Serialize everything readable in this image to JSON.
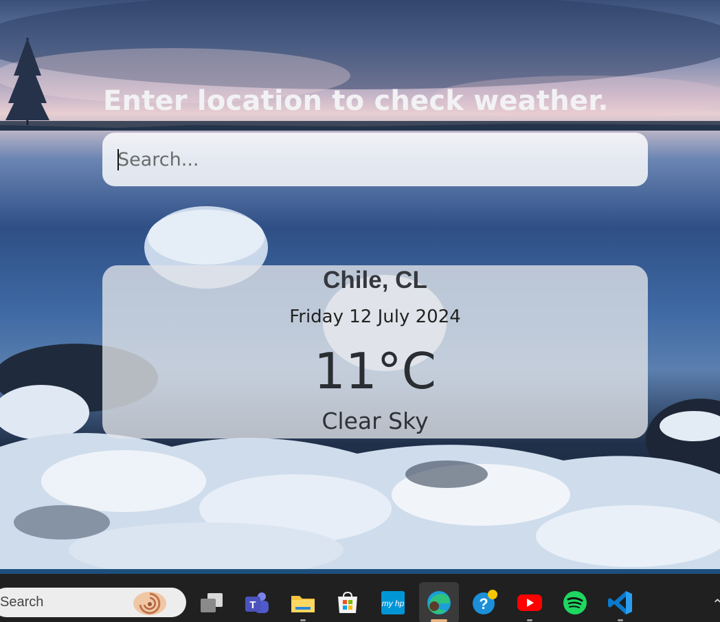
{
  "page": {
    "heading": "Enter location to check weather.",
    "search": {
      "placeholder": "Search...",
      "value": ""
    }
  },
  "weather": {
    "location": "Chile, CL",
    "date": "Friday 12 July 2024",
    "temperature": "11°C",
    "condition": "Clear Sky"
  },
  "taskbar": {
    "search_label": "Search",
    "apps": [
      "task-view",
      "teams",
      "file-explorer",
      "microsoft-store",
      "myhp",
      "edge",
      "get-help",
      "youtube",
      "spotify",
      "vscode"
    ],
    "active_app": "edge"
  },
  "colors": {
    "card_background": "#e1e4e8",
    "heading_text": "#f2f2f4",
    "taskbar": "#202020",
    "taskbar_accent": "#1d4f7c"
  }
}
